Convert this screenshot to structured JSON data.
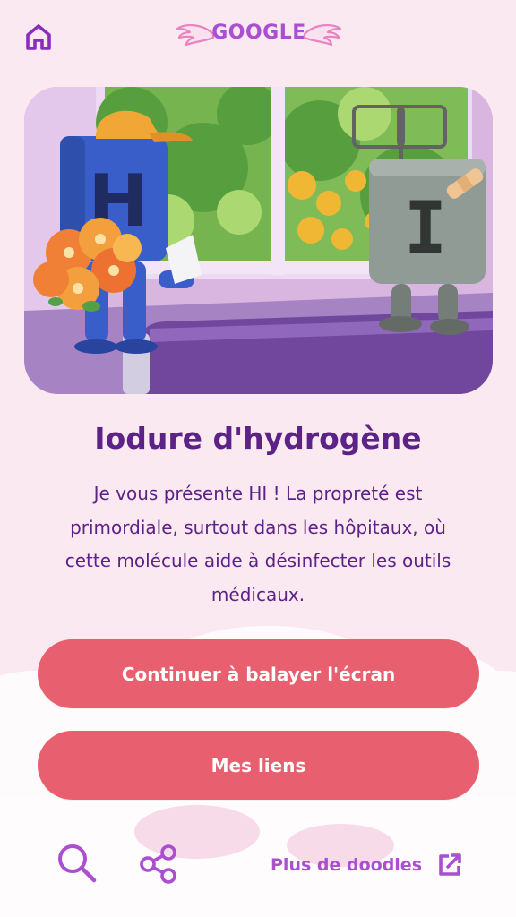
{
  "header": {
    "home_icon": "home-icon",
    "logo_text": "GOOGLE"
  },
  "card": {
    "title": "Iodure d'hydrogène",
    "description": "Je vous présente HI ! La propreté est primordiale, surtout dans les hôpitaux, où cette molécule aide à désinfecter les outils médicaux.",
    "hero": {
      "left_character_letter": "H",
      "right_character_letter": "I"
    }
  },
  "actions": {
    "continue_label": "Continuer à balayer l'écran",
    "links_label": "Mes liens"
  },
  "footer": {
    "search_icon": "search-icon",
    "share_icon": "share-icon",
    "more_doodles_label": "Plus de doodles",
    "external_icon": "external-link-icon"
  },
  "colors": {
    "background": "#fbe9f1",
    "primary_text": "#5c2287",
    "accent_purple": "#a94fd0",
    "button": "#e8606f",
    "button_text": "#ffffff"
  }
}
